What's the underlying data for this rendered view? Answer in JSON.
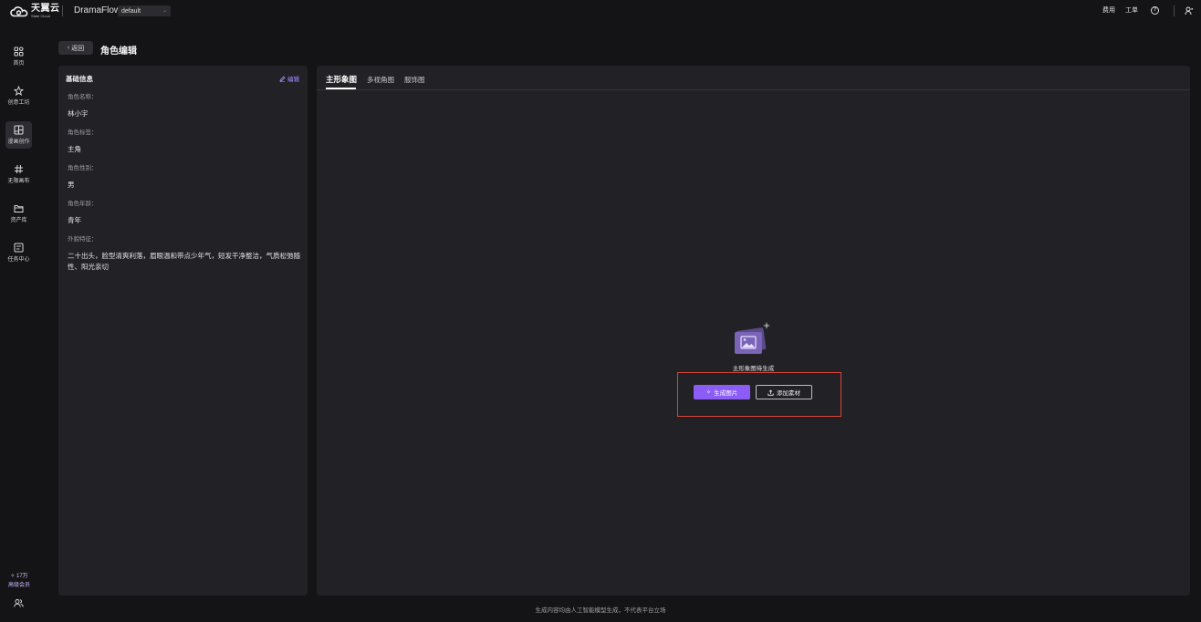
{
  "topbar": {
    "logo_cn": "天翼云",
    "logo_en": "State Cloud",
    "app_name": "DramaFlow",
    "space": "default",
    "fee_label": "费用",
    "ticket_label": "工单",
    "help_icon": "help-circle-icon",
    "user_icon": "user-icon"
  },
  "sidebar": {
    "items": [
      {
        "label": "首页",
        "icon": "grid-icon"
      },
      {
        "label": "创意工坊",
        "icon": "sparkle-star-icon"
      },
      {
        "label": "漫画创作",
        "icon": "comic-panels-icon"
      },
      {
        "label": "无限画布",
        "icon": "hash-canvas-icon"
      },
      {
        "label": "资产库",
        "icon": "folder-icon"
      },
      {
        "label": "任务中心",
        "icon": "task-list-icon"
      }
    ],
    "quota": "17万",
    "member": "高级会员"
  },
  "header": {
    "back_label": "返回",
    "title": "角色编辑"
  },
  "basic_info": {
    "title": "基础信息",
    "edit_label": "编辑",
    "fields": [
      {
        "label": "角色名称：",
        "value": "林小宇"
      },
      {
        "label": "角色标签：",
        "value": "主角"
      },
      {
        "label": "角色性别：",
        "value": "男"
      },
      {
        "label": "角色年龄：",
        "value": "青年"
      },
      {
        "label": "外貌特征：",
        "value": "二十出头，脸型清爽利落，眉眼温和带点少年气，短发干净整洁，气质松弛随性、阳光亲切"
      }
    ]
  },
  "image_panel": {
    "tabs": [
      {
        "label": "主形象图"
      },
      {
        "label": "多视角图"
      },
      {
        "label": "服饰图"
      }
    ],
    "empty_text": "主形象图待生成",
    "generate_label": "生成图片",
    "add_material_label": "添加素材"
  },
  "footer": {
    "disclaimer": "生成内容均由人工智能模型生成，不代表平台立场"
  },
  "colors": {
    "accent": "#8b5cf6",
    "highlight": "#d9423a",
    "panel": "#222226",
    "background": "#141416"
  }
}
